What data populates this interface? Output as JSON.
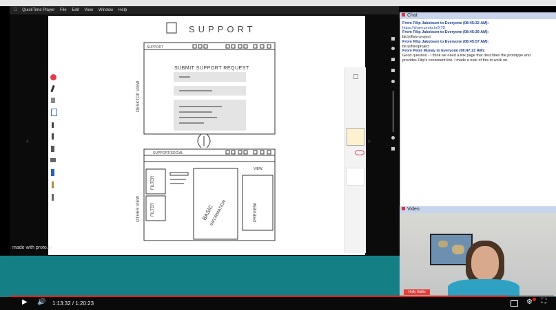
{
  "app": {
    "mac_menu": [
      "QuickTime Player",
      "File",
      "Edit",
      "View",
      "Window",
      "Help"
    ]
  },
  "whiteboard": {
    "title": "SUPPORT",
    "desktop_view_label": "DESKTOP VIEW",
    "other_view_label": "OTHER VIEW",
    "form_heading": "SUBMIT SUPPORT REQUEST",
    "basic_label": "BASIC",
    "information_label": "INFORMATION",
    "preview_label": "PREVIEW",
    "filter_label_1": "FILTER",
    "filter_label_2": "FILTER",
    "window_title_1": "SUPPORT",
    "window_title_2": "SUPPORT/SOCIAL",
    "request_label": "VIEW"
  },
  "watermark": "made with proto.io",
  "chat": {
    "title": "Chat",
    "messages": [
      {
        "from": "From Filip Jakobsen to Everyone (08:45:32 AM):",
        "text": "https://share.proto.io/X7D"
      },
      {
        "from": "From Filip Jakobsen to Everyone (08:45:39 AM):",
        "text": "bit.ly/fixio-project"
      },
      {
        "from": "From Filip Jakobsen to Everyone (08:45:57 AM):",
        "text": "bit.ly/fixioproject"
      },
      {
        "from": "From Peter Munay to Everyone (08:47:21 AM):",
        "text": "Good question - I think we need a link page that describes the prototype and",
        "text2": "provides Filip's consistent link. I made a note of this to work on."
      }
    ]
  },
  "video": {
    "title": "Video",
    "name_tag": "Holly Hallin"
  },
  "player": {
    "time": "1:13:32 / 1:20:23",
    "progress": 0.915
  },
  "colors": {
    "teal": "#157f86",
    "progress_red": "#e62117",
    "chat_from": "#1a3c8f"
  }
}
